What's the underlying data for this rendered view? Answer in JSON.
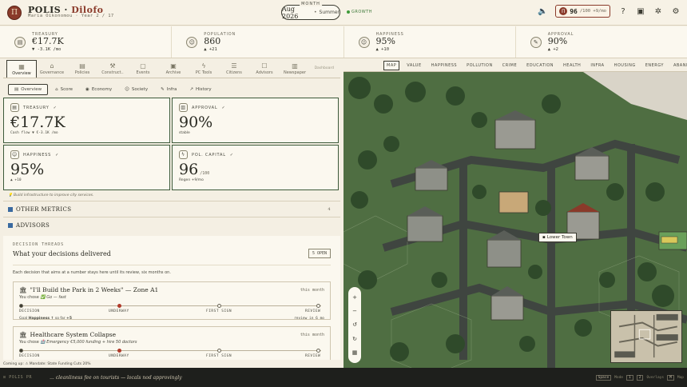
{
  "header": {
    "logo_letter": "Π",
    "title": "POLIS",
    "title_sep": "·",
    "city": "Dilofo",
    "subtitle": "Maria Oikonomou · Year 2 / 17",
    "month_label": "MONTH",
    "month_value": "Aug 2026",
    "month_sep": "•",
    "season": "Summer",
    "growth": "GROWTH",
    "pc_letter": "Π",
    "pc_value": "96",
    "pc_sub": "/100 +9/mo"
  },
  "stats": [
    {
      "label": "TREASURY",
      "value": "€17.7K",
      "delta": "▼ -3.1K /mo",
      "icon": "treasury-icon",
      "glyph": "▤"
    },
    {
      "label": "POPULATION",
      "value": "860",
      "delta": "▲ +21",
      "icon": "population-icon",
      "glyph": "☺"
    },
    {
      "label": "HAPPINESS",
      "value": "95%",
      "delta": "▲ +10",
      "icon": "happiness-icon",
      "glyph": "☺"
    },
    {
      "label": "APPROVAL",
      "value": "90%",
      "delta": "▲ +2",
      "icon": "approval-icon",
      "glyph": "✎"
    }
  ],
  "nav": [
    {
      "label": "Overview",
      "glyph": "▦",
      "active": true
    },
    {
      "label": "Governance",
      "glyph": "⌂"
    },
    {
      "label": "Policies",
      "glyph": "▤"
    },
    {
      "label": "Construct..",
      "glyph": "⚒"
    },
    {
      "label": "Events",
      "glyph": "▢"
    },
    {
      "label": "Archive",
      "glyph": "▣"
    },
    {
      "label": "PC Tools",
      "glyph": "ϟ"
    },
    {
      "label": "Citizens",
      "glyph": "☰"
    },
    {
      "label": "Advisors",
      "glyph": "☐"
    },
    {
      "label": "Newspaper",
      "glyph": "▥"
    }
  ],
  "nav_extra": "Dashboard",
  "subnav": [
    {
      "label": "Overview",
      "glyph": "▤",
      "active": true
    },
    {
      "label": "Score",
      "glyph": "⌂"
    },
    {
      "label": "Economy",
      "glyph": "◉"
    },
    {
      "label": "Society",
      "glyph": "☺"
    },
    {
      "label": "Infra",
      "glyph": "✎"
    },
    {
      "label": "History",
      "glyph": "↗"
    }
  ],
  "cards": {
    "treasury": {
      "label": "TREASURY",
      "check": "✓",
      "value": "€17.7K",
      "sub": "Cash flow ▼ €-3.1K /mo"
    },
    "approval": {
      "label": "APPROVAL",
      "check": "✓",
      "value": "90%",
      "sub": "stable"
    },
    "happiness": {
      "label": "HAPPINESS",
      "check": "✓",
      "value": "95%",
      "sub": "▲ +10"
    },
    "capital": {
      "label": "POL. CAPITAL",
      "check": "✓",
      "value": "96",
      "value_sm": "/100",
      "sub": "Regen +9/mo"
    }
  },
  "hint": "💡 Build infrastructure to improve city services.",
  "sections": {
    "other_metrics": "OTHER METRICS",
    "other_count": "4",
    "advisors": "ADVISORS"
  },
  "threads": {
    "label": "DECISION THREADS",
    "title": "What your decisions delivered",
    "open": "5 OPEN",
    "desc": "Each decision that aims at a number stays here until its review, six months on.",
    "items": [
      {
        "title": "\"I'll Build the Park in 2 Weeks\" — Zone A1",
        "when": "this month",
        "chose_prefix": "You chose",
        "chose": "✅ Go — fast",
        "stages": [
          "DECISION",
          "UNDERWAY",
          "FIRST SIGN",
          "REVIEW"
        ],
        "goal_prefix": "Goal",
        "goal": "Happiness ↑",
        "goal_sofar": "so far",
        "goal_delta": "+5",
        "review": "review in 6 mo"
      },
      {
        "title": "Healthcare System Collapse",
        "when": "this month",
        "chose_prefix": "You chose",
        "chose": "🏥 Emergency €5,000 funding + hire 50 doctors",
        "stages": [
          "DECISION",
          "UNDERWAY",
          "FIRST SIGN",
          "REVIEW"
        ]
      }
    ]
  },
  "map": {
    "tabs": [
      "MAP",
      "VALUE",
      "HAPPINESS",
      "POLLUTION",
      "CRIME",
      "EDUCATION",
      "HEALTH",
      "INFRA",
      "HOUSING",
      "ENERGY",
      "ABANDONED"
    ],
    "active_tab": "MAP",
    "place_label": "Lower Town",
    "zoom": [
      "+",
      "−",
      "↺",
      "↻",
      "▦"
    ],
    "minimap_labels": [
      "Mountain",
      "Village",
      "Industrial"
    ]
  },
  "coming_up": "Coming up: ⚠ Mandate: State Funding Cuts 20%",
  "footer": {
    "brand": "⊡ POLIS PR",
    "ticker": "... cleanliness fee on tourists — locals nod approvingly",
    "right_kbd": "Space",
    "right_text": "Mode",
    "right_k1": "1",
    "right_k2": "2",
    "right_text2": "Overlays",
    "right_k3": "M",
    "right_text3": "Map"
  }
}
